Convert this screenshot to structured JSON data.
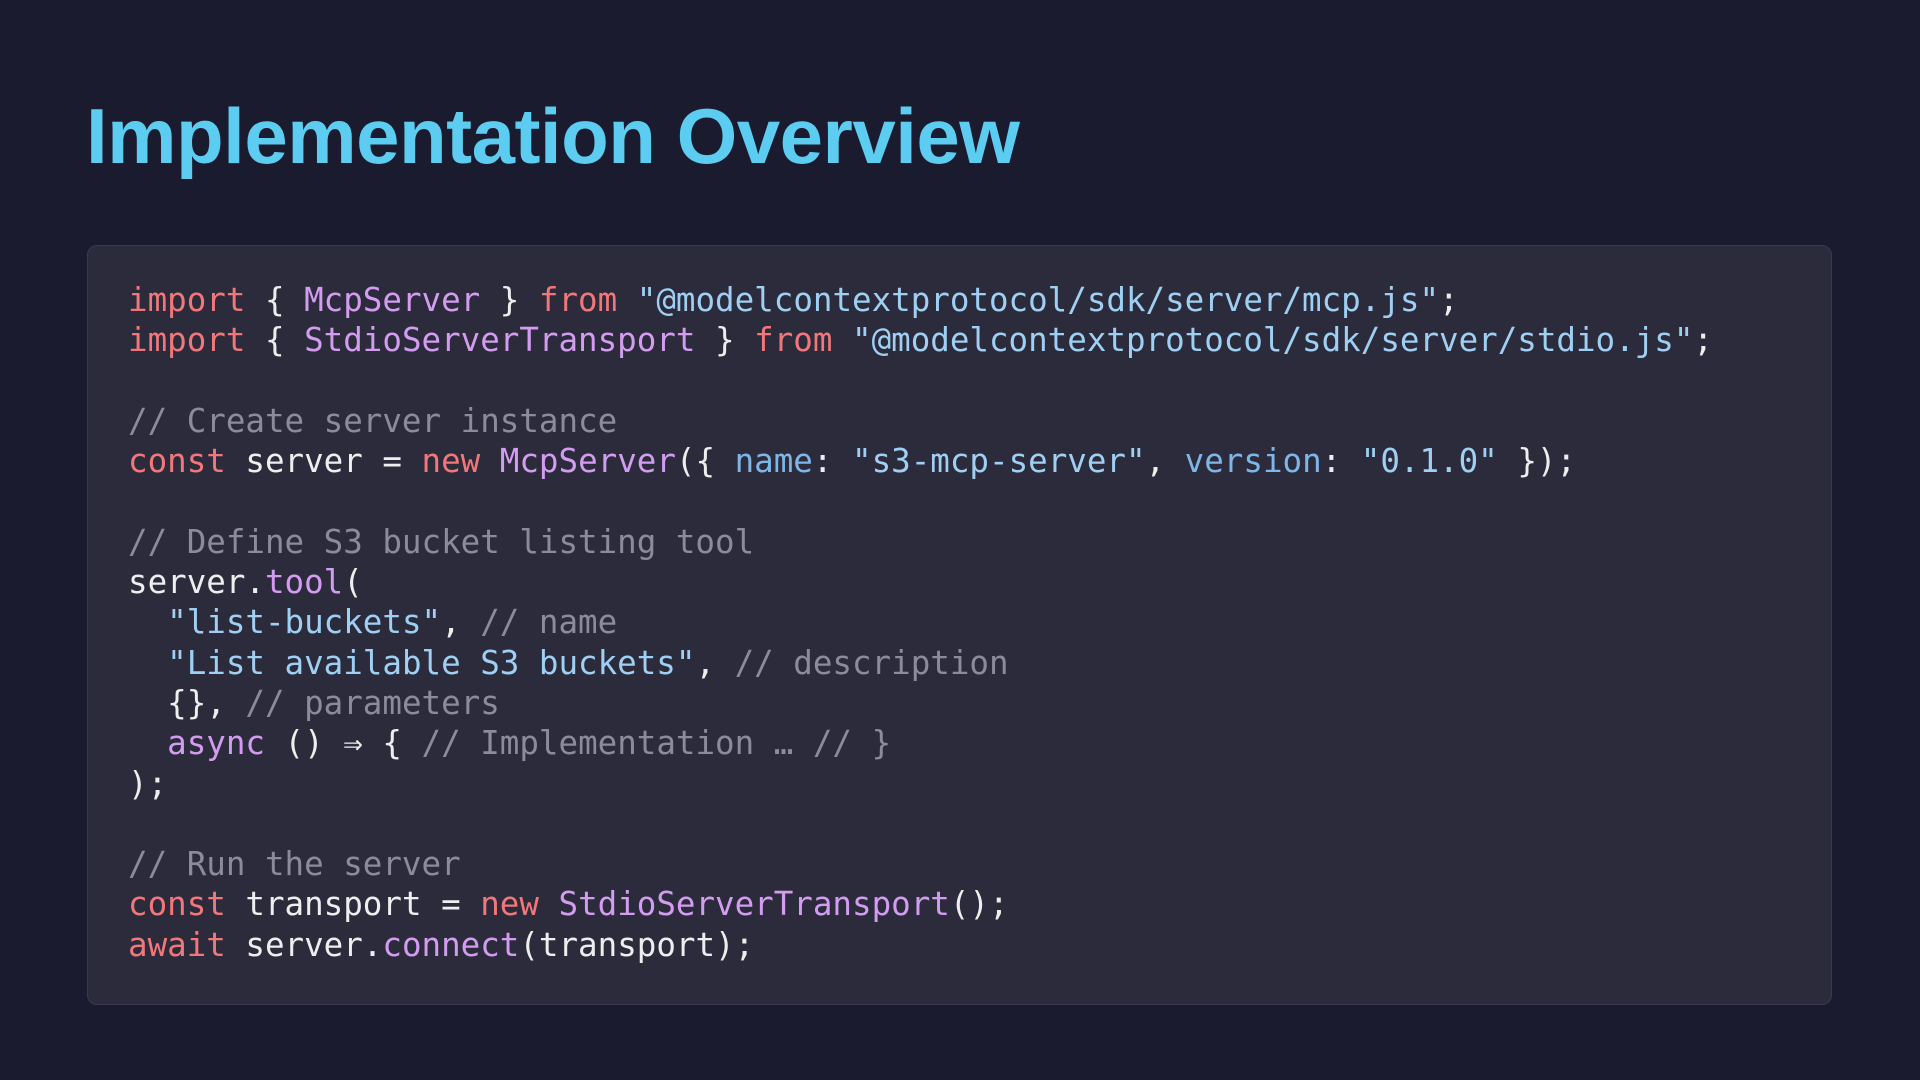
{
  "slide": {
    "title": "Implementation Overview"
  },
  "code": {
    "language": "javascript",
    "lines": [
      [
        [
          "kw",
          "import"
        ],
        [
          "pl",
          " { "
        ],
        [
          "fn",
          "McpServer"
        ],
        [
          "pl",
          " } "
        ],
        [
          "kw",
          "from"
        ],
        [
          "pl",
          " "
        ],
        [
          "str",
          "\"@modelcontextprotocol/sdk/server/mcp.js\""
        ],
        [
          "pl",
          ";"
        ]
      ],
      [
        [
          "kw",
          "import"
        ],
        [
          "pl",
          " { "
        ],
        [
          "fn",
          "StdioServerTransport"
        ],
        [
          "pl",
          " } "
        ],
        [
          "kw",
          "from"
        ],
        [
          "pl",
          " "
        ],
        [
          "str",
          "\"@modelcontextprotocol/sdk/server/stdio.js\""
        ],
        [
          "pl",
          ";"
        ]
      ],
      [],
      [
        [
          "cm",
          "// Create server instance"
        ]
      ],
      [
        [
          "kw",
          "const"
        ],
        [
          "pl",
          " server = "
        ],
        [
          "kw",
          "new"
        ],
        [
          "pl",
          " "
        ],
        [
          "fn",
          "McpServer"
        ],
        [
          "pl",
          "({ "
        ],
        [
          "prop",
          "name"
        ],
        [
          "pl",
          ": "
        ],
        [
          "str",
          "\"s3-mcp-server\""
        ],
        [
          "pl",
          ", "
        ],
        [
          "prop",
          "version"
        ],
        [
          "pl",
          ": "
        ],
        [
          "str",
          "\"0.1.0\""
        ],
        [
          "pl",
          " });"
        ]
      ],
      [],
      [
        [
          "cm",
          "// Define S3 bucket listing tool"
        ]
      ],
      [
        [
          "pl",
          "server."
        ],
        [
          "fn",
          "tool"
        ],
        [
          "pl",
          "("
        ]
      ],
      [
        [
          "pl",
          "  "
        ],
        [
          "str",
          "\"list-buckets\""
        ],
        [
          "pl",
          ", "
        ],
        [
          "cm",
          "// name"
        ]
      ],
      [
        [
          "pl",
          "  "
        ],
        [
          "str",
          "\"List available S3 buckets\""
        ],
        [
          "pl",
          ", "
        ],
        [
          "cm",
          "// description"
        ]
      ],
      [
        [
          "pl",
          "  {}, "
        ],
        [
          "cm",
          "// parameters"
        ]
      ],
      [
        [
          "pl",
          "  "
        ],
        [
          "fn",
          "async"
        ],
        [
          "pl",
          " () ⇒ { "
        ],
        [
          "cm",
          "// Implementation … // }"
        ]
      ],
      [
        [
          "pl",
          ");"
        ]
      ],
      [],
      [
        [
          "cm",
          "// Run the server"
        ]
      ],
      [
        [
          "kw",
          "const"
        ],
        [
          "pl",
          " transport = "
        ],
        [
          "kw",
          "new"
        ],
        [
          "pl",
          " "
        ],
        [
          "fn",
          "StdioServerTransport"
        ],
        [
          "pl",
          "();"
        ]
      ],
      [
        [
          "kw",
          "await"
        ],
        [
          "pl",
          " server."
        ],
        [
          "fn",
          "connect"
        ],
        [
          "pl",
          "(transport);"
        ]
      ]
    ]
  }
}
